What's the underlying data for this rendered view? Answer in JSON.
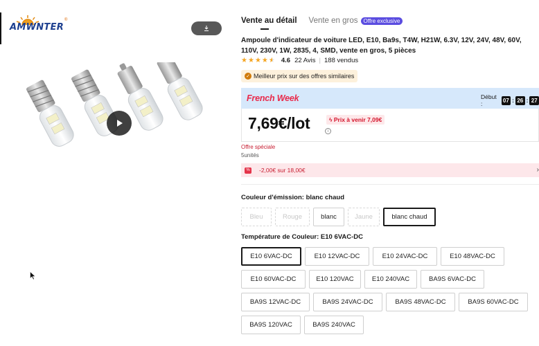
{
  "brand": {
    "logo_text": "AMWNTER",
    "reg_mark": "®"
  },
  "tabs": [
    {
      "label": "Vente au détail",
      "active": true
    },
    {
      "label": "Vente en gros",
      "active": false,
      "badge": "Offre exclusive"
    }
  ],
  "product": {
    "title": "Ampoule d'indicateur de voiture LED, E10, Ba9s, T4W, H21W, 6.3V, 12V, 24V, 48V, 60V, 110V, 230V, 1W, 2835, 4, SMD, vente en gros, 5 pièces",
    "rating": "4.6",
    "stars": 4.5,
    "reviews": "22 Avis",
    "sold": "188 vendus",
    "best_price": "Meilleur prix sur des offres similaires"
  },
  "promo": {
    "title": "French Week",
    "countdown_label": "Début :",
    "hours": "07",
    "minutes": "26",
    "seconds": "27"
  },
  "pricing": {
    "price": "7,69€/lot",
    "future_price": "Prix à venir 7,09€",
    "special_offer": "Offre spéciale",
    "units": "5unités",
    "coupon": "-2,00€ sur 18,00€"
  },
  "color_section": {
    "label": "Couleur d'émission: blanc chaud",
    "options": [
      {
        "label": "Bleu",
        "state": "disabled"
      },
      {
        "label": "Rouge",
        "state": "disabled"
      },
      {
        "label": "blanc",
        "state": "normal"
      },
      {
        "label": "Jaune",
        "state": "disabled"
      },
      {
        "label": "blanc chaud",
        "state": "selected"
      }
    ]
  },
  "temp_section": {
    "label": "Température de Couleur: E10 6VAC-DC",
    "rows": [
      [
        "E10 6VAC-DC",
        "E10 12VAC-DC",
        "E10 24VAC-DC",
        "E10 48VAC-DC"
      ],
      [
        "E10 60VAC-DC",
        "E10 120VAC",
        "E10 240VAC",
        "BA9S 6VAC-DC"
      ],
      [
        "BA9S 12VAC-DC",
        "BA9S 24VAC-DC",
        "BA9S 48VAC-DC",
        "BA9S 60VAC-DC"
      ],
      [
        "BA9S 120VAC",
        "BA9S 240VAC"
      ]
    ],
    "selected": "E10 6VAC-DC"
  },
  "colors": {
    "accent_red": "#e9294a",
    "price_red": "#d4142b",
    "banner_blue": "#d6e8fb",
    "star": "#f5a623",
    "badge_purple": "#5b4de0"
  },
  "icons": [
    "download-icon",
    "play-icon",
    "best-price-icon",
    "lightning-icon",
    "info-icon",
    "coupon-icon",
    "chevron-right-icon",
    "mouse-cursor-icon"
  ]
}
